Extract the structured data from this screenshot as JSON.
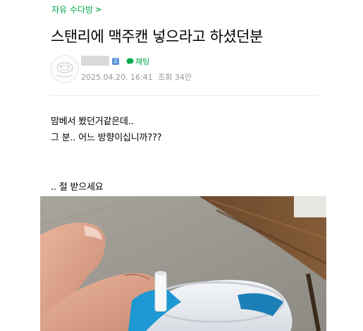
{
  "board": {
    "name": "자유 수다방",
    "chevron": ">"
  },
  "post": {
    "title": "스탠리에 맥주캔 넣으라고 하셨던분",
    "author": {
      "level_badge": "2",
      "chat_label": "채팅"
    },
    "meta": {
      "date": "2025.04.20. 16:41",
      "views": "조회 34만"
    },
    "body": [
      "맘베서 봤던거같은데..",
      "그 분.. 어느 방향이십니까???",
      ".. 절 받으세요"
    ],
    "image": {
      "alt": "photo"
    }
  },
  "colors": {
    "accent": "#03a94d",
    "meta": "#979797",
    "badge": "#5b93d4"
  },
  "icons": {
    "chat": "chat-bubble-icon",
    "chevron": "chevron-right-icon"
  }
}
